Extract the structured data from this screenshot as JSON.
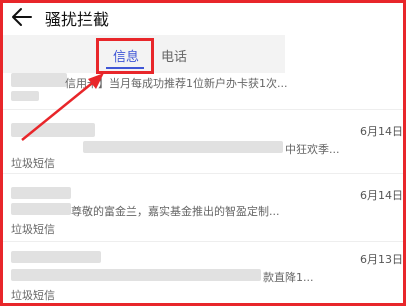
{
  "header": {
    "title": "骚扰拦截"
  },
  "tabs": [
    {
      "label": "信息"
    },
    {
      "label": "电话"
    }
  ],
  "messages": [
    {
      "sender": "",
      "snippet": "信用卡】当月每成功推荐1位新户办卡获1次...",
      "date": "",
      "tag": ""
    },
    {
      "sender": "",
      "snippet": "中狂欢季...",
      "date": "6月14日",
      "tag": "垃圾短信"
    },
    {
      "sender": "",
      "snippet": "尊敬的富金兰，嘉实基金推出的智盈定制...",
      "date": "6月14日",
      "tag": "垃圾短信"
    },
    {
      "sender": "",
      "snippet": "款直降1...",
      "date": "6月13日",
      "tag": "垃圾短信"
    }
  ],
  "colors": {
    "accent": "#3f56d6",
    "annotation": "#e8262a"
  }
}
